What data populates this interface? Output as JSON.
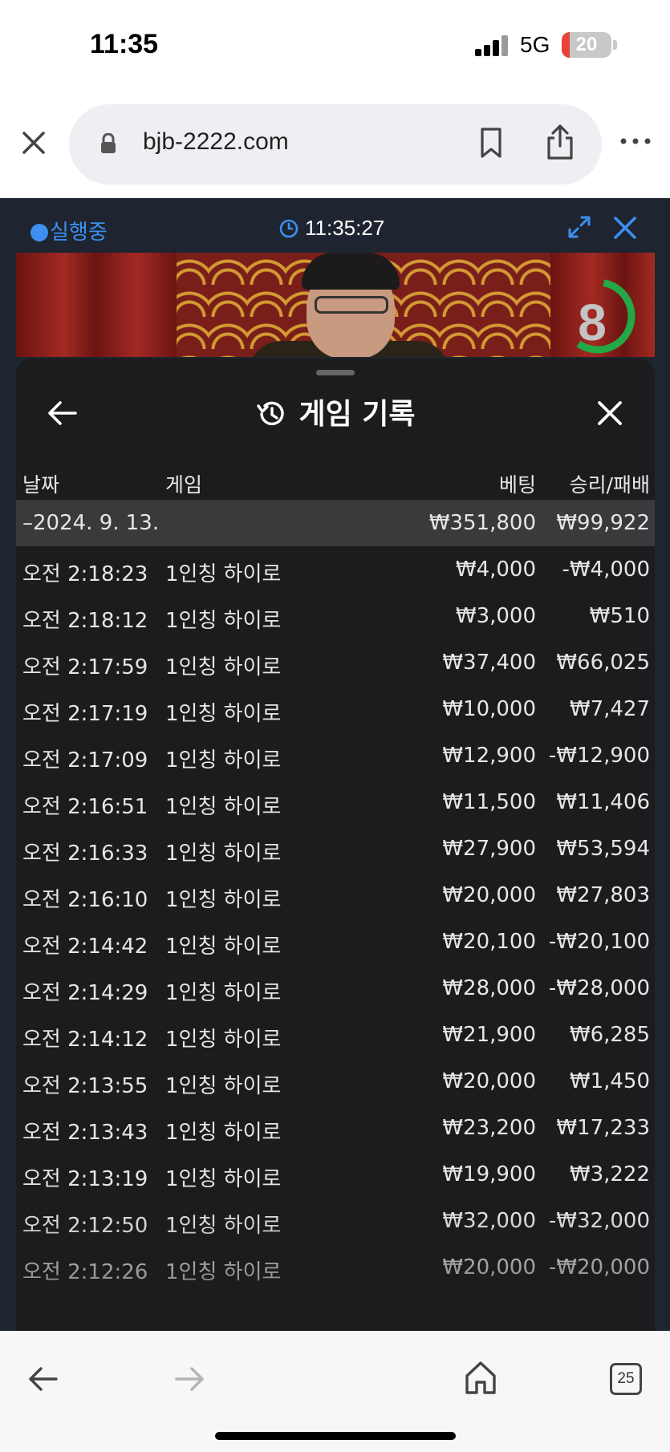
{
  "status_bar": {
    "time": "11:35",
    "network": "5G",
    "battery_level": "20",
    "battery_color": "#e8433b"
  },
  "browser": {
    "url": "bjb-2222.com",
    "tab_count": "25",
    "icons": [
      "close-icon",
      "lock-icon",
      "bookmark-icon",
      "share-icon",
      "more-icon",
      "back-arrow-icon",
      "forward-arrow-icon",
      "home-icon",
      "tabs-icon"
    ]
  },
  "app": {
    "running_label": "실행중",
    "clock": "11:35:27",
    "accent_color": "#3d8ff0",
    "countdown": "8",
    "countdown_ring_color": "#22a845"
  },
  "sheet": {
    "title": "게임 기록",
    "columns": {
      "date": "날짜",
      "game": "게임",
      "bet": "베팅",
      "result": "승리/패배"
    },
    "summary": {
      "date": "–2024. 9. 13.",
      "bet": "₩351,800",
      "result": "₩99,922"
    },
    "rows": [
      {
        "time": "오전 2:18:23",
        "game": "1인칭 하이로",
        "bet": "₩4,000",
        "result": "-₩4,000"
      },
      {
        "time": "오전 2:18:12",
        "game": "1인칭 하이로",
        "bet": "₩3,000",
        "result": "₩510"
      },
      {
        "time": "오전 2:17:59",
        "game": "1인칭 하이로",
        "bet": "₩37,400",
        "result": "₩66,025"
      },
      {
        "time": "오전 2:17:19",
        "game": "1인칭 하이로",
        "bet": "₩10,000",
        "result": "₩7,427"
      },
      {
        "time": "오전 2:17:09",
        "game": "1인칭 하이로",
        "bet": "₩12,900",
        "result": "-₩12,900"
      },
      {
        "time": "오전 2:16:51",
        "game": "1인칭 하이로",
        "bet": "₩11,500",
        "result": "₩11,406"
      },
      {
        "time": "오전 2:16:33",
        "game": "1인칭 하이로",
        "bet": "₩27,900",
        "result": "₩53,594"
      },
      {
        "time": "오전 2:16:10",
        "game": "1인칭 하이로",
        "bet": "₩20,000",
        "result": "₩27,803"
      },
      {
        "time": "오전 2:14:42",
        "game": "1인칭 하이로",
        "bet": "₩20,100",
        "result": "-₩20,100"
      },
      {
        "time": "오전 2:14:29",
        "game": "1인칭 하이로",
        "bet": "₩28,000",
        "result": "-₩28,000"
      },
      {
        "time": "오전 2:14:12",
        "game": "1인칭 하이로",
        "bet": "₩21,900",
        "result": "₩6,285"
      },
      {
        "time": "오전 2:13:55",
        "game": "1인칭 하이로",
        "bet": "₩20,000",
        "result": "₩1,450"
      },
      {
        "time": "오전 2:13:43",
        "game": "1인칭 하이로",
        "bet": "₩23,200",
        "result": "₩17,233"
      },
      {
        "time": "오전 2:13:19",
        "game": "1인칭 하이로",
        "bet": "₩19,900",
        "result": "₩3,222"
      },
      {
        "time": "오전 2:12:50",
        "game": "1인칭 하이로",
        "bet": "₩32,000",
        "result": "-₩32,000"
      },
      {
        "time": "오전 2:12:26",
        "game": "1인칭 하이로",
        "bet": "₩20,000",
        "result": "-₩20,000"
      }
    ]
  }
}
